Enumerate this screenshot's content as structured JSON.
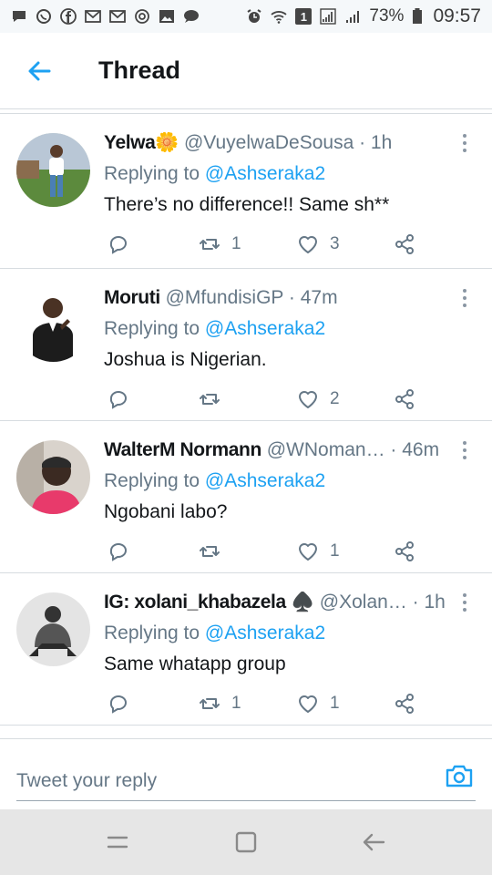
{
  "status_bar": {
    "battery_percent": "73%",
    "time": "09:57",
    "sim_label": "1",
    "left_icons": [
      "chat-icon",
      "whatsapp-icon",
      "facebook-icon",
      "gmail-icon",
      "gmail-icon",
      "email-icon",
      "gallery-icon",
      "chat-icon"
    ],
    "right_icons": [
      "alarm-icon",
      "wifi-icon",
      "sim-icon",
      "signal-icon",
      "signal-icon",
      "battery-icon"
    ]
  },
  "header": {
    "title": "Thread",
    "back_icon": "back-arrow-icon"
  },
  "colors": {
    "accent": "#1da1f2",
    "secondary_text": "#657786",
    "primary_text": "#14171a",
    "divider": "#d7dce0"
  },
  "tweets": [
    {
      "name": "Yelwa🌼",
      "meta": " @VuyelwaDeSousa · 1h",
      "replying_prefix": "Replying to ",
      "replying_to": "@Ashseraka2",
      "text": "There’s no difference!! Same sh**",
      "retweets": "1",
      "likes": "3"
    },
    {
      "name": "Moruti",
      "meta": " @MfundisiGP · 47m",
      "replying_prefix": "Replying to ",
      "replying_to": "@Ashseraka2",
      "text": "Joshua is Nigerian.",
      "retweets": "",
      "likes": "2"
    },
    {
      "name": "WalterM Normann",
      "meta": " @WNoman… · 46m",
      "replying_prefix": "Replying to ",
      "replying_to": "@Ashseraka2",
      "text": "Ngobani labo?",
      "retweets": "",
      "likes": "1"
    },
    {
      "name": "IG: xolani_khabazela ♠️",
      "meta": " @Xolan… · 1h",
      "replying_prefix": "Replying to ",
      "replying_to": "@Ashseraka2",
      "text": "Same whatapp group",
      "retweets": "1",
      "likes": "1"
    }
  ],
  "reply_bar": {
    "placeholder": "Tweet your reply",
    "camera_icon": "camera-icon"
  },
  "nav_bar": {
    "icons": [
      "recent-apps-icon",
      "home-icon",
      "back-icon"
    ]
  }
}
